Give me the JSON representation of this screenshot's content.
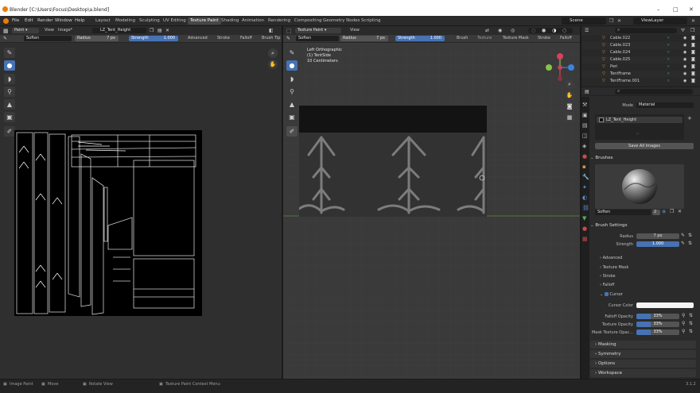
{
  "window": {
    "title": "Blender [C:\\Users\\Focus\\Desktop\\a.blend]",
    "minimize": "–",
    "maximize": "□",
    "close": "✕"
  },
  "menu": [
    "File",
    "Edit",
    "Render",
    "Window",
    "Help"
  ],
  "workspaces": [
    "Layout",
    "Modeling",
    "Sculpting",
    "UV Editing",
    "Texture Paint",
    "Shading",
    "Animation",
    "Rendering",
    "Compositing",
    "Geometry Nodes",
    "Scripting"
  ],
  "active_workspace": "Texture Paint",
  "scene": "Scene",
  "view_layer": "ViewLayer",
  "image_editor": {
    "mode": "Paint",
    "view": "View",
    "image_menu": "Image*",
    "image_name": "LZ_Tent_Height",
    "brush": "Soften",
    "radius_label": "Radius",
    "radius": "7 px",
    "strength_label": "Strength",
    "strength": "1.000",
    "extra": [
      "Advanced",
      "Stroke",
      "Falloff",
      "Brush Tip"
    ]
  },
  "viewport": {
    "mode": "Texture Paint",
    "view": "View",
    "brush": "Soften",
    "radius_label": "Radius",
    "radius": "7 px",
    "strength_label": "Strength",
    "strength": "1.000",
    "extra": [
      "Brush",
      "Texture",
      "Texture Mask",
      "Stroke",
      "Falloff"
    ],
    "overlay_line1": "Left Orthographic",
    "overlay_line2": "(1) TentSide",
    "overlay_line3": "10 Centimeters"
  },
  "gizmo": {
    "x": "X",
    "y": "Y",
    "z": "Z"
  },
  "outliner": {
    "items": [
      {
        "name": "Cable.022",
        "color": "#e6a640"
      },
      {
        "name": "Cable.023",
        "color": "#e6a640"
      },
      {
        "name": "Cable.024",
        "color": "#e6a640"
      },
      {
        "name": "Cable.025",
        "color": "#e6a640"
      },
      {
        "name": "Peri",
        "color": "#e6a640"
      },
      {
        "name": "TentFrame",
        "color": "#e6a640"
      },
      {
        "name": "TentFrame.001",
        "color": "#e6a640"
      }
    ]
  },
  "properties": {
    "mode_label": "Mode",
    "mode_value": "Material",
    "texture_slot": "LZ_Tent_Height",
    "save_all": "Save All Images",
    "brushes_header": "Brushes",
    "brush_name": "Soften",
    "brush_users": "2",
    "brush_settings_header": "Brush Settings",
    "radius_label": "Radius",
    "radius": "7 px",
    "strength_label": "Strength",
    "strength": "1.000",
    "advanced": "Advanced",
    "texture_mask": "Texture Mask",
    "stroke": "Stroke",
    "falloff": "Falloff",
    "cursor": "Cursor",
    "cursor_color_label": "Cursor Color",
    "falloff_opacity_label": "Falloff Opacity",
    "falloff_opacity": "33%",
    "falloff_opacity_value": 0.33,
    "texture_opacity_label": "Texture Opacity",
    "texture_opacity": "33%",
    "texture_opacity_value": 0.33,
    "mask_opacity_label": "Mask Texture Opac...",
    "mask_opacity": "33%",
    "mask_opacity_value": 0.33,
    "masking": "Masking",
    "symmetry": "Symmetry",
    "options": "Options",
    "workspace": "Workspace"
  },
  "status": {
    "left": "Image Paint",
    "move": "Move",
    "rotate": "Rotate View",
    "context": "Texture Paint Context Menu",
    "version": "3.1.2"
  }
}
